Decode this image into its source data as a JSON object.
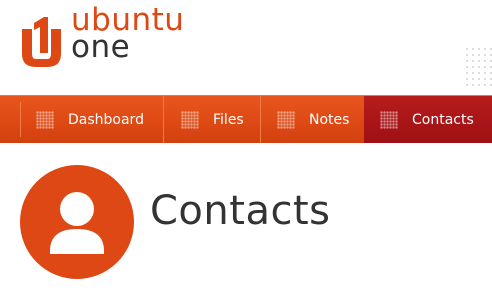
{
  "brand": {
    "name_top": "ubuntu",
    "name_bottom": "one",
    "logo_icon": "ubuntu-one-logo-icon",
    "accent_color": "#dd4814"
  },
  "nav": {
    "items": [
      {
        "label": "Dashboard",
        "icon": "dashboard-icon",
        "active": false
      },
      {
        "label": "Files",
        "icon": "files-icon",
        "active": false
      },
      {
        "label": "Notes",
        "icon": "notes-icon",
        "active": false
      },
      {
        "label": "Contacts",
        "icon": "contacts-icon",
        "active": true
      }
    ],
    "active_color": "#ad1717"
  },
  "main": {
    "title": "Contacts",
    "avatar_icon": "user-avatar-icon"
  }
}
